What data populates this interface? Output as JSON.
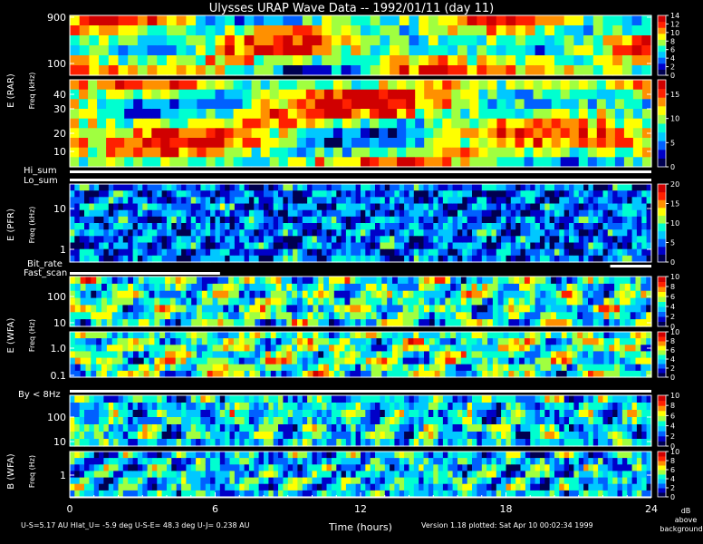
{
  "title": "Ulysses URAP Wave Data -- 1992/01/11  (day 11)",
  "footer": {
    "left": "U-S=5.17 AU  Hlat_U= -5.9 deg  U-S-E= 48.3 deg  U-J= 0.238 AU",
    "xlabel": "Time (hours)",
    "right": "Version 1.18 plotted: Sat Apr 10 00:02:34 1999",
    "cb_units": [
      "dB",
      "above",
      "background"
    ]
  },
  "chart_data": {
    "type": "heatmap",
    "title": "Ulysses URAP Wave Data -- 1992/01/11  (day 11)",
    "xlabel": "Time (hours)",
    "xlim": [
      0,
      24
    ],
    "x_ticks": [
      "0",
      "6",
      "12",
      "18",
      "24"
    ],
    "units": "dB above background",
    "groups": [
      {
        "label": "E (RAR)",
        "ylabel": "Freq (kHz)"
      },
      {
        "label": "E (PFR)",
        "ylabel": "Freq (kHz)"
      },
      {
        "label": "E (WFA)",
        "ylabel": "Freq (Hz)"
      },
      {
        "label": "B (WFA)",
        "ylabel": "Freq (Hz)"
      }
    ],
    "strips": [
      {
        "label": "Hi_sum"
      },
      {
        "label": "Lo_sum"
      },
      {
        "label": "Bit_rate"
      },
      {
        "label": "Fast_scan"
      },
      {
        "label": "By < 8Hz"
      }
    ],
    "panels": [
      {
        "name": "rar-high",
        "y_ticks": [
          "900",
          "100"
        ],
        "cbar": [
          0,
          14
        ],
        "cbar_ticks": [
          "0",
          "2",
          "4",
          "6",
          "8",
          "10",
          "12",
          "14"
        ]
      },
      {
        "name": "rar-low",
        "y_ticks": [
          "40",
          "30",
          "20",
          "10"
        ],
        "cbar": [
          0,
          18
        ],
        "cbar_ticks": [
          "0",
          "5",
          "10",
          "15"
        ]
      },
      {
        "name": "pfr",
        "y_ticks": [
          "10",
          "1"
        ],
        "cbar": [
          0,
          20
        ],
        "cbar_ticks": [
          "0",
          "5",
          "10",
          "15",
          "20"
        ]
      },
      {
        "name": "wfa-e-high",
        "y_ticks": [
          "100",
          "10"
        ],
        "cbar": [
          0,
          10
        ],
        "cbar_ticks": [
          "0",
          "2",
          "4",
          "6",
          "8",
          "10"
        ]
      },
      {
        "name": "wfa-e-low",
        "y_ticks": [
          "1.0",
          "0.1"
        ],
        "cbar": [
          0,
          10
        ],
        "cbar_ticks": [
          "0",
          "2",
          "4",
          "6",
          "8",
          "10"
        ]
      },
      {
        "name": "wfa-b-high",
        "y_ticks": [
          "100",
          "10"
        ],
        "cbar": [
          0,
          10
        ],
        "cbar_ticks": [
          "0",
          "2",
          "4",
          "6",
          "8",
          "10"
        ]
      },
      {
        "name": "wfa-b-low",
        "y_ticks": [
          "1"
        ],
        "cbar": [
          0,
          10
        ],
        "cbar_ticks": [
          "0",
          "2",
          "4",
          "6",
          "8",
          "10"
        ]
      }
    ]
  },
  "colors": {
    "scale": [
      "#000050",
      "#0000c8",
      "#0060ff",
      "#00c8ff",
      "#00ffd0",
      "#a0ff40",
      "#ffff00",
      "#ff9000",
      "#ff2000",
      "#d00000"
    ]
  }
}
